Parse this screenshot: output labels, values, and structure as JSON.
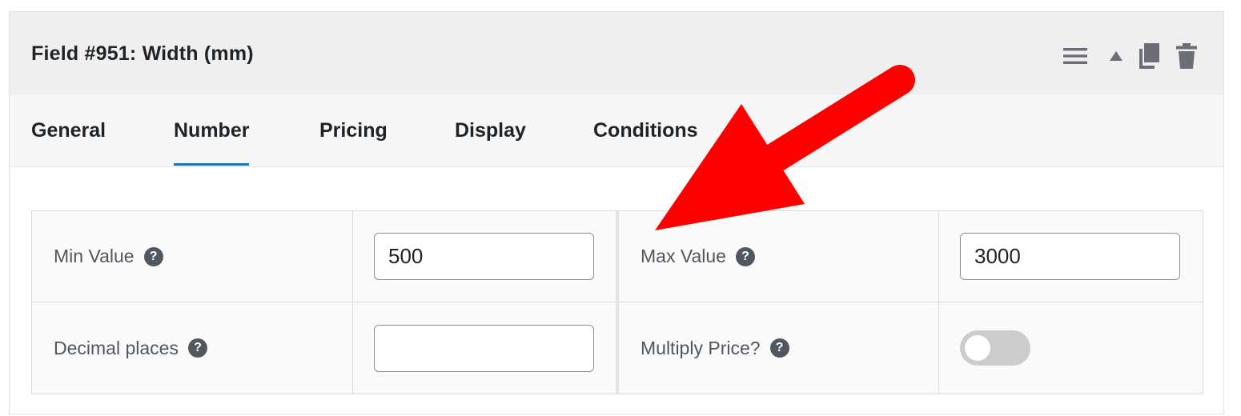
{
  "field": {
    "title": "Field #951: Width (mm)"
  },
  "header_icons": [
    "hamburger-menu-icon",
    "triangle-up-icon",
    "copy-icon",
    "trash-icon"
  ],
  "tabs": [
    {
      "label": "General",
      "active": false
    },
    {
      "label": "Number",
      "active": true
    },
    {
      "label": "Pricing",
      "active": false
    },
    {
      "label": "Display",
      "active": false
    },
    {
      "label": "Conditions",
      "active": false
    }
  ],
  "settings": {
    "min_value": {
      "label": "Min Value",
      "value": "500"
    },
    "max_value": {
      "label": "Max Value",
      "value": "3000"
    },
    "decimal_places": {
      "label": "Decimal places",
      "value": ""
    },
    "multiply_price": {
      "label": "Multiply Price?",
      "enabled": false
    }
  },
  "help_glyph": "?",
  "colors": {
    "header_bg": "#efefef",
    "tab_bar_bg": "#f7f7f7",
    "active_tab_underline": "#2271b1",
    "annotation_arrow": "#ff0000",
    "toggle_off": "#cccccc"
  }
}
